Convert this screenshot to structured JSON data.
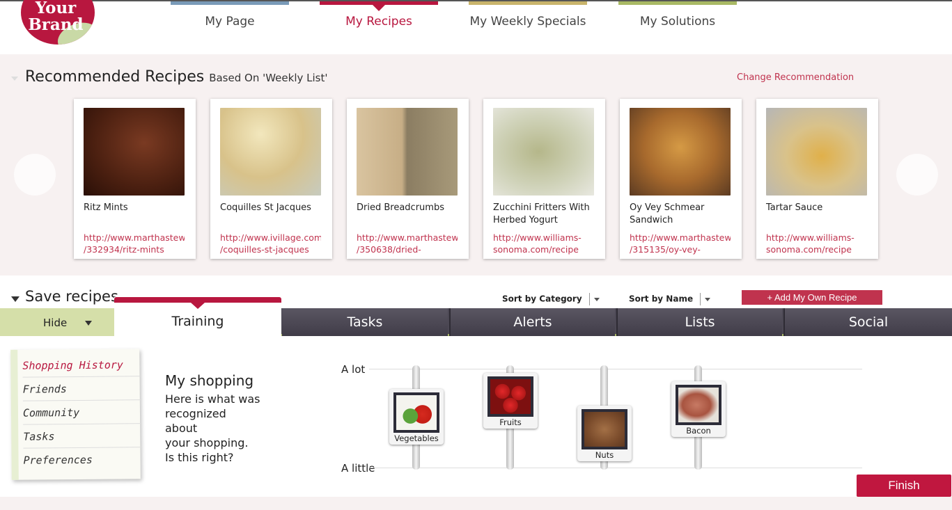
{
  "brand": {
    "logo_text_line1": "Your",
    "logo_text_line2": "Brand"
  },
  "nav": {
    "items": [
      {
        "label": "My Page",
        "color": "#7a9bb8"
      },
      {
        "label": "My Recipes",
        "color": "#b8173f",
        "active": true
      },
      {
        "label": "My Weekly Specials",
        "color": "#c9b46b"
      },
      {
        "label": "My Solutions",
        "color": "#a9b964"
      }
    ]
  },
  "recommended": {
    "title": "Recommended Recipes",
    "subtitle": "Based On 'Weekly List'",
    "change_link": "Change Recommendation",
    "cards": [
      {
        "name": "Ritz Mints",
        "url_line1": "http://www.marthastewart.com",
        "url_line2": "/332934/ritz-mints"
      },
      {
        "name": "Coquilles St Jacques",
        "url_line1": "http://www.ivillage.com",
        "url_line2": "/coquilles-st-jacques"
      },
      {
        "name": "Dried Breadcrumbs",
        "url_line1": "http://www.marthastewart.com",
        "url_line2": "/350638/dried-"
      },
      {
        "name": "Zucchini Fritters With Herbed Yogurt",
        "url_line1": "http://www.williams-",
        "url_line2": "sonoma.com/recipe"
      },
      {
        "name": "Oy Vey Schmear Sandwich",
        "url_line1": "http://www.marthastewart.com",
        "url_line2": "/315135/oy-vey-"
      },
      {
        "name": "Tartar Sauce",
        "url_line1": "http://www.williams-",
        "url_line2": "sonoma.com/recipe"
      }
    ]
  },
  "save": {
    "title": "Save recipes",
    "sort_category": "Sort by Category",
    "sort_name": "Sort by Name",
    "add_button": "+ Add My Own Recipe"
  },
  "tabs": {
    "hide": "Hide",
    "training": "Training",
    "items": [
      "Tasks",
      "Alerts",
      "Lists",
      "Social"
    ]
  },
  "training": {
    "menu": [
      "Shopping History",
      "Friends",
      "Community",
      "Tasks",
      "Preferences"
    ],
    "title": "My shopping",
    "text_lines": [
      "Here is what was",
      "recognized",
      "about",
      "your shopping.",
      "Is this right?"
    ],
    "axis_high": "A lot",
    "axis_low": "A little",
    "sliders": [
      {
        "label": "Vegetables",
        "level": 0.45
      },
      {
        "label": "Fruits",
        "level": 0.65
      },
      {
        "label": "Nuts",
        "level": 0.2
      },
      {
        "label": "Bacon",
        "level": 0.55
      }
    ],
    "finish": "Finish"
  }
}
